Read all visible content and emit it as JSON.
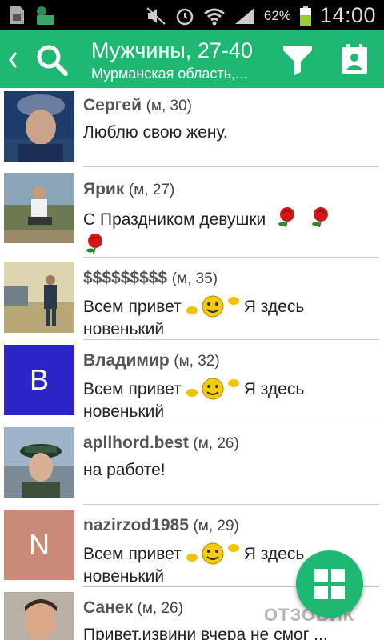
{
  "status_bar": {
    "battery_percent": "62%",
    "time": "14:00",
    "icons": [
      "sim-icon",
      "cloud-app-icon",
      "mute-icon",
      "alarm-icon",
      "wifi-icon",
      "signal-icon",
      "battery-icon"
    ]
  },
  "header": {
    "title": "Мужчины, 27-40",
    "subtitle": "Мурманская область,...",
    "color": "#1fb872"
  },
  "users": [
    {
      "name": "Сергей",
      "meta": "(м, 30)",
      "message": "Люблю свою жену.",
      "avatar": "photo"
    },
    {
      "name": "Ярик",
      "meta": "(м, 27)",
      "message": "С Праздником девушки",
      "avatar": "photo",
      "emoji": "rose x3"
    },
    {
      "name": "$$$$$$$$$",
      "meta": "(м, 35)",
      "message_before": "Всем привет",
      "message_after": "Я здесь",
      "message_line2": "новенький",
      "avatar": "photo"
    },
    {
      "name": "Владимир",
      "meta": "(м, 32)",
      "message_before": "Всем привет",
      "message_after": "Я здесь",
      "message_line2": "новенький",
      "avatar_letter": "В",
      "avatar_color": "#2b25c8"
    },
    {
      "name": "apllhord.best",
      "meta": "(м, 26)",
      "message": "на работе!",
      "avatar": "photo"
    },
    {
      "name": "nazirzod1985",
      "meta": "(м, 29)",
      "message_before": "Всем привет",
      "message_after": "Я здесь",
      "message_line2": "новенький",
      "avatar_letter": "N",
      "avatar_color": "#c98a78"
    },
    {
      "name": "Санек",
      "meta": "(м, 26)",
      "message": "Привет.извини вчера не смог ...",
      "avatar": "photo"
    }
  ],
  "watermark": "ОТЗОВИК"
}
